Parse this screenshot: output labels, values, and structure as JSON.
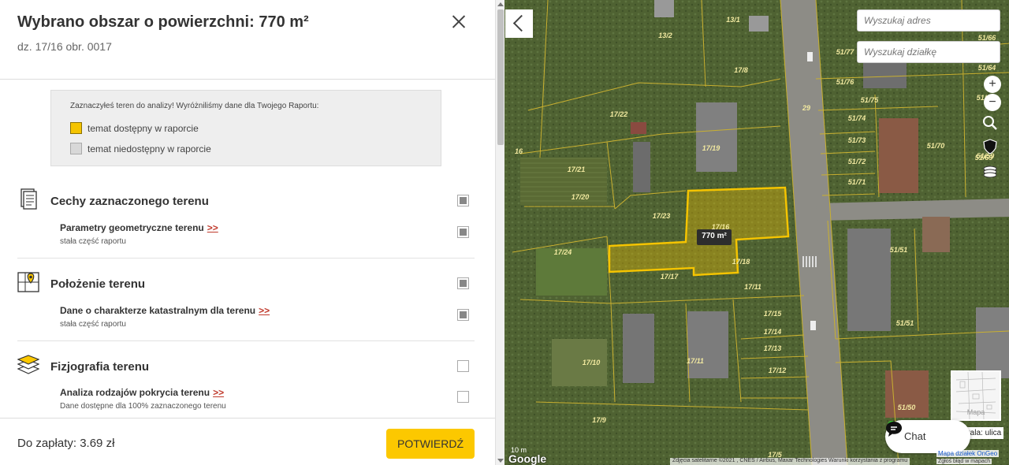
{
  "panel": {
    "title": "Wybrano obszar o powierzchni: 770 m²",
    "subtitle": "dz. 17/16 obr. 0017",
    "legend": {
      "intro": "Zaznaczyłeś teren do analizy! Wyróżniliśmy dane dla Twojego Raportu:",
      "available": "temat dostępny w raporcie",
      "unavailable": "temat niedostępny w raporcie"
    },
    "sections": [
      {
        "title": "Cechy zaznaczonego terenu",
        "icon": "document-icon",
        "item_title": "Parametry geometryczne terenu",
        "item_link": ">>",
        "item_note": "stała część raportu"
      },
      {
        "title": "Położenie terenu",
        "icon": "map-pin-icon",
        "item_title": "Dane o charakterze katastralnym dla terenu",
        "item_link": ">>",
        "item_note": "stała część raportu"
      },
      {
        "title": "Fizjografia terenu",
        "icon": "layers-icon",
        "item_title": "Analiza rodzajów pokrycia terenu",
        "item_link": ">>",
        "item_note": "Dane dostępne dla 100% zaznaczonego terenu"
      }
    ],
    "footer": {
      "price": "Do zapłaty: 3.69 zł",
      "confirm": "POTWIERDŹ"
    }
  },
  "map": {
    "search_address_placeholder": "Wyszukaj adres",
    "search_parcel_placeholder": "Wyszukaj działkę",
    "selected_area_label": "770 m²",
    "parcel_labels": [
      "13/1",
      "13/2",
      "17/8",
      "17/22",
      "17/19",
      "16",
      "17/21",
      "17/20",
      "17/23",
      "17/16",
      "17/24",
      "17/18",
      "17/17",
      "17/11",
      "17/15",
      "17/14",
      "17/13",
      "17/10",
      "17/11",
      "17/12",
      "17/9",
      "17/5",
      "29",
      "51/77",
      "51/76",
      "51/75",
      "51/74",
      "51/73",
      "51/72",
      "51/71",
      "51/70",
      "51/69",
      "51/66",
      "51/64",
      "51/63",
      "51/59",
      "51/51",
      "51/51",
      "51/50"
    ],
    "minimap_label": "Mapa",
    "scale_label": "Skala: ulica",
    "chat_label": "Chat",
    "google_label": "Google",
    "map_scale_text": "10 m",
    "attribution": "Zdjęcia satelitarne ©2021 , CNES / Airbus, Maxar Technologies    Warunki korzystania z programu",
    "ongeo_link": "Mapa działek OnGeo",
    "report_error": "Zgłoś błąd w mapach"
  },
  "colors": {
    "accent": "#fcc800",
    "parcel_line": "#f5c400",
    "link": "#c0392b"
  }
}
